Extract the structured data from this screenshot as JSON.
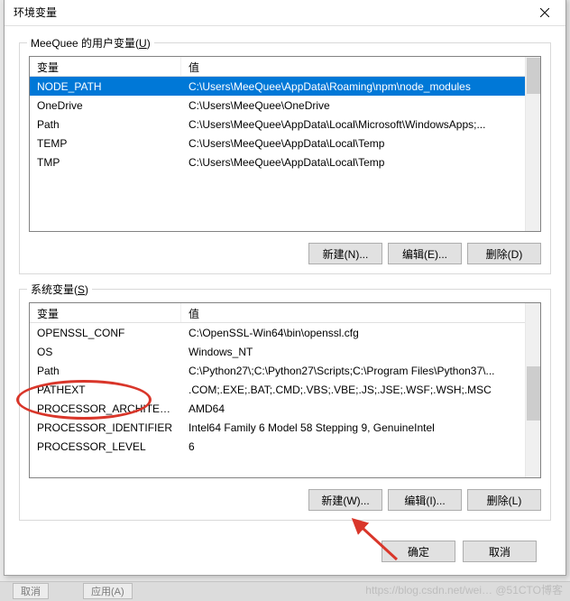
{
  "title": "环境变量",
  "user_group_label_prefix": "MeeQuee 的用户变量(",
  "user_group_label_u": "U",
  "user_group_label_suffix": ")",
  "sys_group_label_prefix": "系统变量(",
  "sys_group_label_s": "S",
  "sys_group_label_suffix": ")",
  "col_var": "变量",
  "col_val": "值",
  "user_rows": [
    {
      "k": "NODE_PATH",
      "v": "C:\\Users\\MeeQuee\\AppData\\Roaming\\npm\\node_modules",
      "sel": true
    },
    {
      "k": "OneDrive",
      "v": "C:\\Users\\MeeQuee\\OneDrive"
    },
    {
      "k": "Path",
      "v": "C:\\Users\\MeeQuee\\AppData\\Local\\Microsoft\\WindowsApps;..."
    },
    {
      "k": "TEMP",
      "v": "C:\\Users\\MeeQuee\\AppData\\Local\\Temp"
    },
    {
      "k": "TMP",
      "v": "C:\\Users\\MeeQuee\\AppData\\Local\\Temp"
    }
  ],
  "sys_rows": [
    {
      "k": "OPENSSL_CONF",
      "v": "C:\\OpenSSL-Win64\\bin\\openssl.cfg"
    },
    {
      "k": "OS",
      "v": "Windows_NT"
    },
    {
      "k": "Path",
      "v": "C:\\Python27\\;C:\\Python27\\Scripts;C:\\Program Files\\Python37\\..."
    },
    {
      "k": "PATHEXT",
      "v": ".COM;.EXE;.BAT;.CMD;.VBS;.VBE;.JS;.JSE;.WSF;.WSH;.MSC"
    },
    {
      "k": "PROCESSOR_ARCHITECT...",
      "v": "AMD64"
    },
    {
      "k": "PROCESSOR_IDENTIFIER",
      "v": "Intel64 Family 6 Model 58 Stepping 9, GenuineIntel"
    },
    {
      "k": "PROCESSOR_LEVEL",
      "v": "6"
    }
  ],
  "btn_new_n": "新建(N)...",
  "btn_edit_e": "编辑(E)...",
  "btn_del_d": "删除(D)",
  "btn_new_w": "新建(W)...",
  "btn_edit_i": "编辑(I)...",
  "btn_del_l": "删除(L)",
  "btn_ok": "确定",
  "btn_cancel": "取消",
  "watermark": "https://blog.csdn.net/wei… @51CTO博客",
  "bg_cancel": "取消",
  "bg_apply": "应用(A)"
}
